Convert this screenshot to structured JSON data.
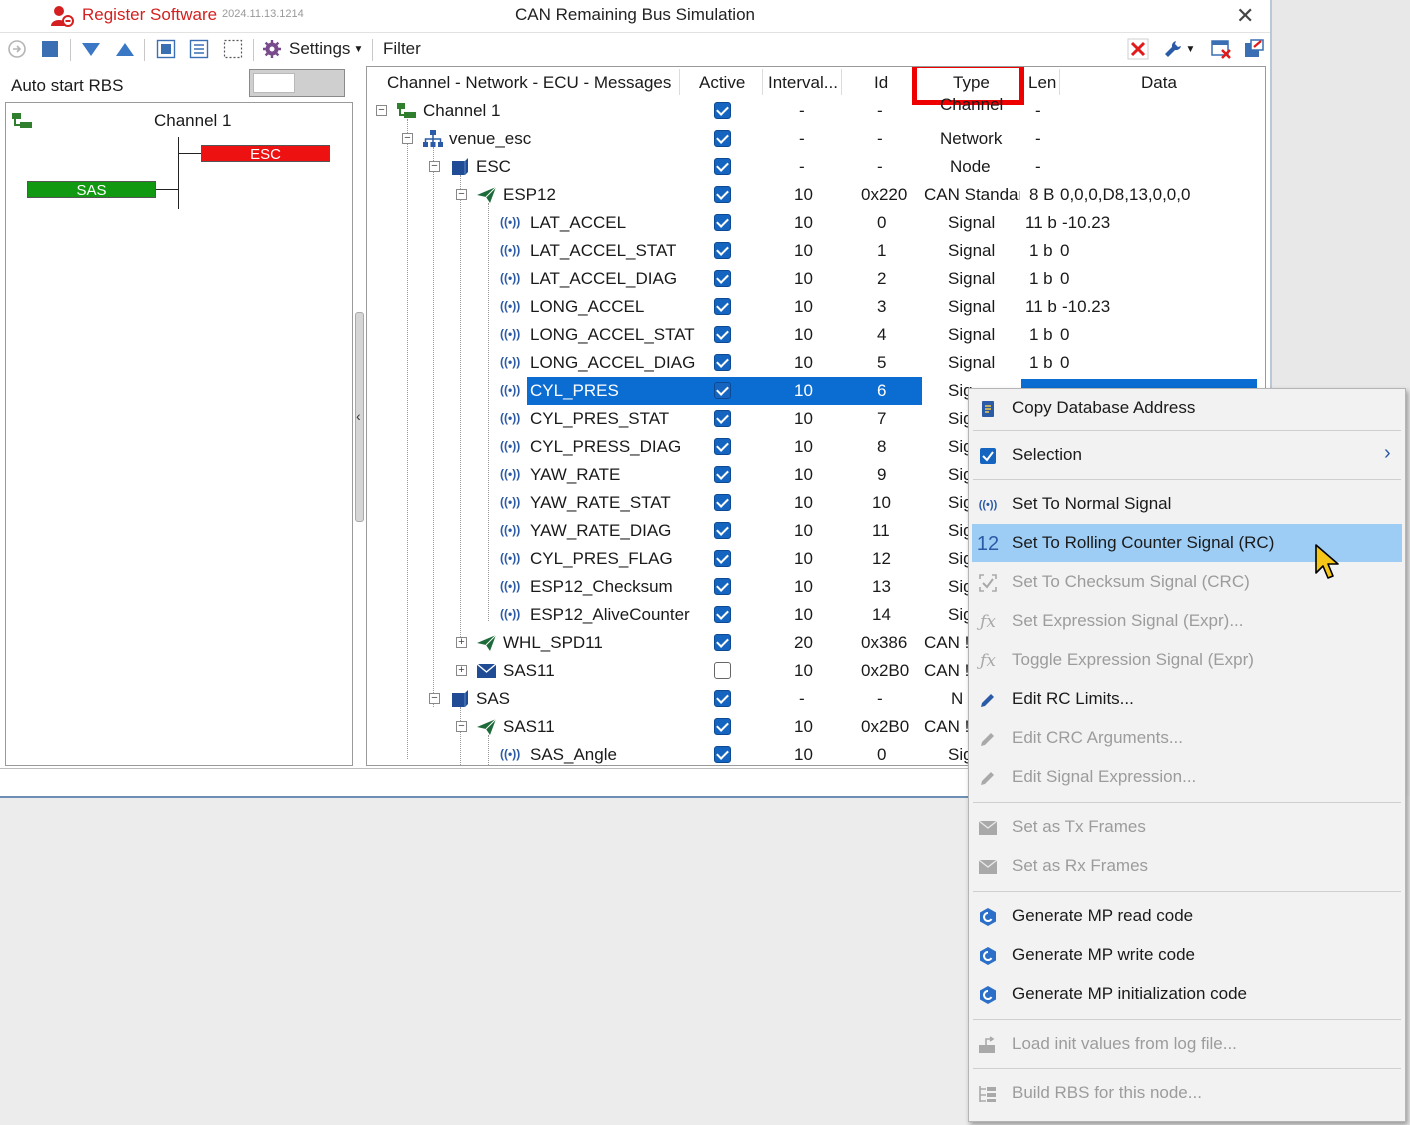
{
  "titlebar": {
    "register_label": "Register Software",
    "version": "2024.11.13.1214",
    "title": "CAN Remaining Bus Simulation",
    "close_glyph": "✕"
  },
  "toolbar": {
    "settings_label": "Settings",
    "filter_label": "Filter"
  },
  "left": {
    "autostart_label": "Auto start RBS",
    "channel_label": "Channel 1",
    "ecu_esc": "ESC",
    "ecu_sas": "SAS",
    "ecu_esc_color": "#ee1111",
    "ecu_sas_color": "#119a11"
  },
  "table": {
    "headers": {
      "tree": "Channel - Network - ECU - Messages",
      "active": "Active",
      "interval": "Interval...",
      "id": "Id",
      "type": "Type",
      "len": "Len",
      "data": "Data"
    },
    "rows": [
      {
        "name": "Channel 1",
        "interval": "-",
        "id": "-",
        "type": "Channel",
        "len": "-",
        "data": ""
      },
      {
        "name": "venue_esc",
        "interval": "-",
        "id": "-",
        "type": "Network",
        "len": "-",
        "data": ""
      },
      {
        "name": "ESC",
        "interval": "-",
        "id": "-",
        "type": "Node",
        "len": "-",
        "data": ""
      },
      {
        "name": "ESP12",
        "interval": "10",
        "id": "0x220",
        "type": "CAN Standar",
        "len": "8 B",
        "data": "0,0,0,D8,13,0,0,0"
      },
      {
        "name": "LAT_ACCEL",
        "interval": "10",
        "id": "0",
        "type": "Signal",
        "len": "11 b",
        "data": "-10.23"
      },
      {
        "name": "LAT_ACCEL_STAT",
        "interval": "10",
        "id": "1",
        "type": "Signal",
        "len": "1 b",
        "data": "0"
      },
      {
        "name": "LAT_ACCEL_DIAG",
        "interval": "10",
        "id": "2",
        "type": "Signal",
        "len": "1 b",
        "data": "0"
      },
      {
        "name": "LONG_ACCEL",
        "interval": "10",
        "id": "3",
        "type": "Signal",
        "len": "11 b",
        "data": "-10.23"
      },
      {
        "name": "LONG_ACCEL_STAT",
        "interval": "10",
        "id": "4",
        "type": "Signal",
        "len": "1 b",
        "data": "0"
      },
      {
        "name": "LONG_ACCEL_DIAG",
        "interval": "10",
        "id": "5",
        "type": "Signal",
        "len": "1 b",
        "data": "0"
      },
      {
        "name": "CYL_PRES",
        "interval": "10",
        "id": "6",
        "type": "Sig",
        "len": "",
        "data": ""
      },
      {
        "name": "CYL_PRES_STAT",
        "interval": "10",
        "id": "7",
        "type": "Sig",
        "len": "",
        "data": ""
      },
      {
        "name": "CYL_PRESS_DIAG",
        "interval": "10",
        "id": "8",
        "type": "Sig",
        "len": "",
        "data": ""
      },
      {
        "name": "YAW_RATE",
        "interval": "10",
        "id": "9",
        "type": "Sig",
        "len": "",
        "data": ""
      },
      {
        "name": "YAW_RATE_STAT",
        "interval": "10",
        "id": "10",
        "type": "Sig",
        "len": "",
        "data": ""
      },
      {
        "name": "YAW_RATE_DIAG",
        "interval": "10",
        "id": "11",
        "type": "Sig",
        "len": "",
        "data": ""
      },
      {
        "name": "CYL_PRES_FLAG",
        "interval": "10",
        "id": "12",
        "type": "Sig",
        "len": "",
        "data": ""
      },
      {
        "name": "ESP12_Checksum",
        "interval": "10",
        "id": "13",
        "type": "Sig",
        "len": "",
        "data": ""
      },
      {
        "name": "ESP12_AliveCounter",
        "interval": "10",
        "id": "14",
        "type": "Sig",
        "len": "",
        "data": ""
      },
      {
        "name": "WHL_SPD11",
        "interval": "20",
        "id": "0x386",
        "type": "CAN !",
        "len": "",
        "data": ""
      },
      {
        "name": "SAS11",
        "interval": "10",
        "id": "0x2B0",
        "type": "CAN !",
        "len": "",
        "data": ""
      },
      {
        "name": "SAS",
        "interval": "-",
        "id": "-",
        "type": "N",
        "len": "",
        "data": ""
      },
      {
        "name": "SAS11",
        "interval": "10",
        "id": "0x2B0",
        "type": "CAN !",
        "len": "",
        "data": ""
      },
      {
        "name": "SAS_Angle",
        "interval": "10",
        "id": "0",
        "type": "Sig",
        "len": "",
        "data": ""
      }
    ]
  },
  "menu": {
    "items": [
      {
        "label": "Copy Database Address",
        "icon": "copy-address-icon"
      },
      {
        "label": "Selection",
        "icon": "checkbox-icon"
      },
      {
        "label": "Set To Normal Signal",
        "icon": "signal-icon"
      },
      {
        "label": "Set To Rolling Counter Signal (RC)",
        "icon": "rolling-counter-icon",
        "icon_text": "12"
      },
      {
        "label": "Set To Checksum Signal (CRC)",
        "icon": "checksum-icon"
      },
      {
        "label": "Set Expression Signal (Expr)...",
        "icon": "function-icon"
      },
      {
        "label": "Toggle Expression Signal (Expr)",
        "icon": "function-icon"
      },
      {
        "label": "Edit RC Limits...",
        "icon": "pencil-icon"
      },
      {
        "label": "Edit CRC Arguments...",
        "icon": "pencil-icon"
      },
      {
        "label": "Edit Signal Expression...",
        "icon": "pencil-icon"
      },
      {
        "label": "Set as Tx Frames",
        "icon": "envelope-icon"
      },
      {
        "label": "Set as Rx Frames",
        "icon": "envelope-icon"
      },
      {
        "label": "Generate MP read code",
        "icon": "cube-icon"
      },
      {
        "label": "Generate MP write code",
        "icon": "cube-icon"
      },
      {
        "label": "Generate MP initialization code",
        "icon": "cube-icon"
      },
      {
        "label": "Load init values from log file...",
        "icon": "load-icon"
      },
      {
        "label": "Build RBS for this node...",
        "icon": "build-icon"
      }
    ],
    "highlight_color": "#9dcdf5"
  },
  "colors": {
    "selection": "#0b6cd1",
    "annotation_box": "#ee0000",
    "checkbox": "#1565c0"
  }
}
